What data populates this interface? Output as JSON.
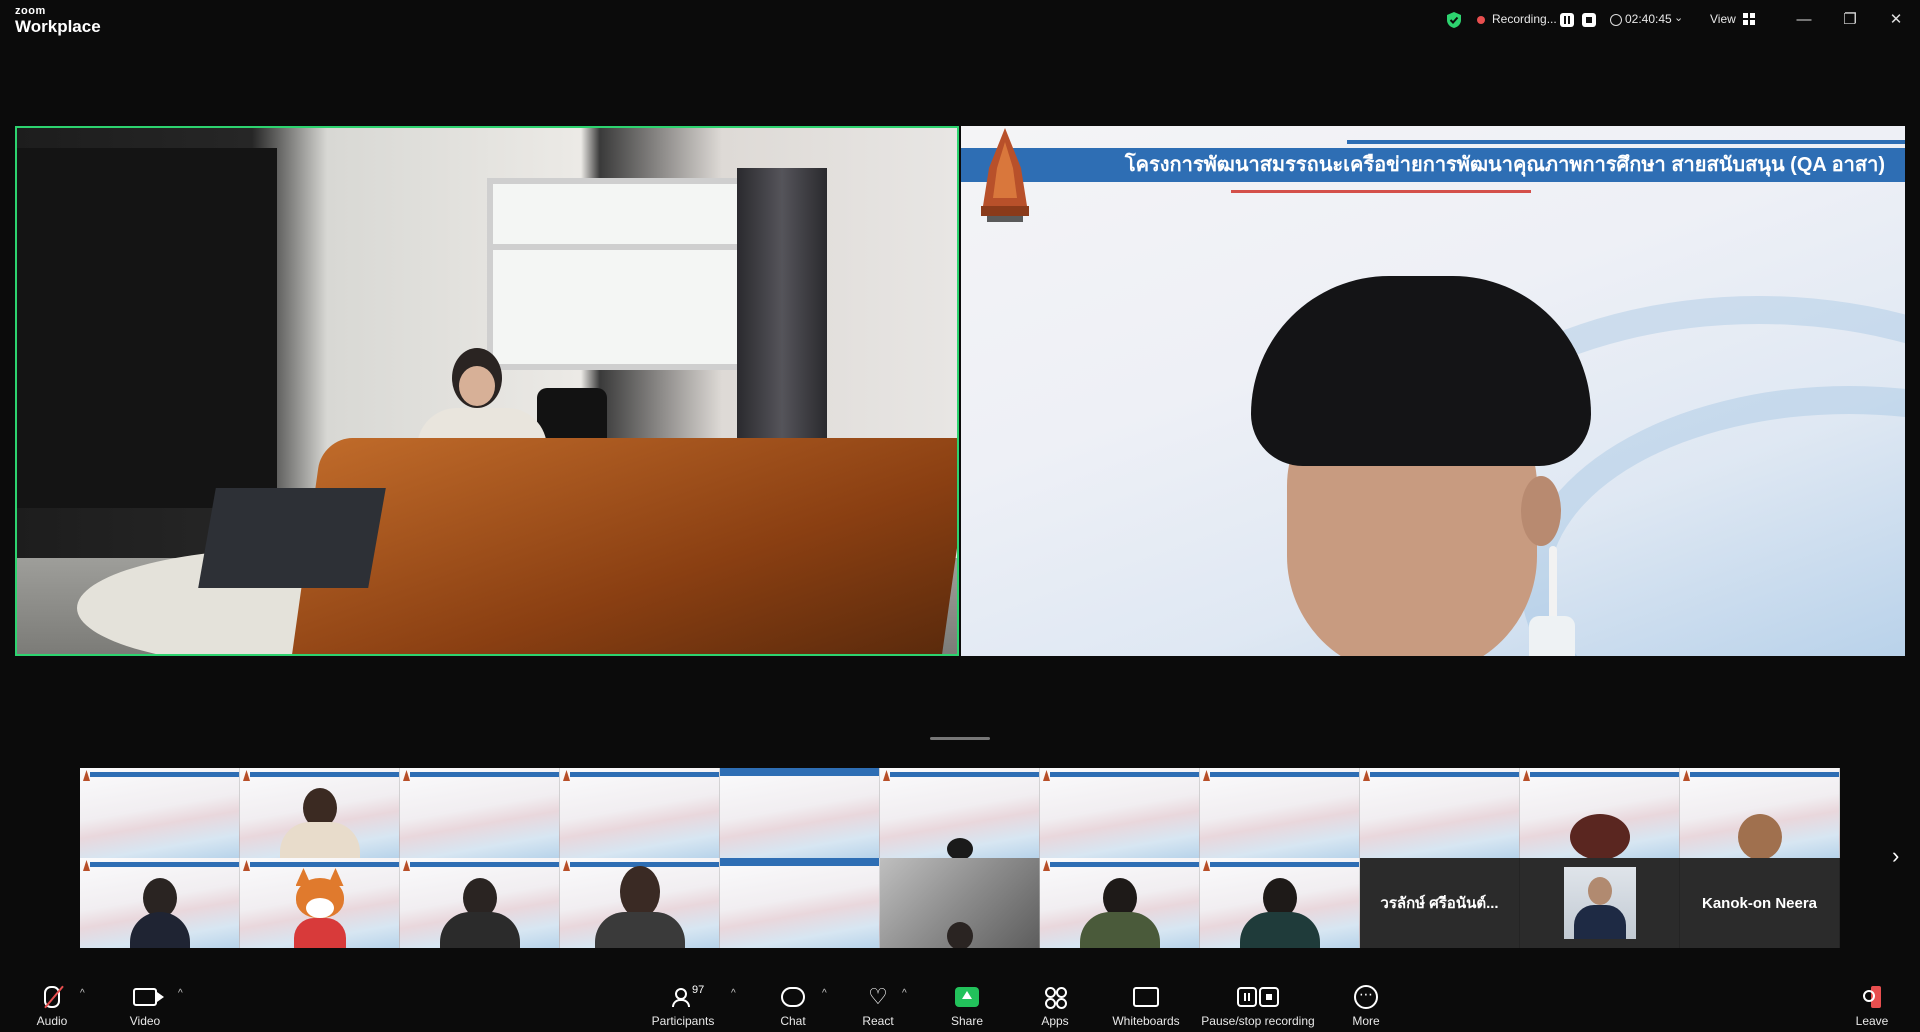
{
  "app": {
    "brand_small": "zoom",
    "brand_large": "Workplace"
  },
  "topbar": {
    "recording_label": "Recording...",
    "timer": "02:40:45",
    "view_label": "View",
    "timer_caret": "⌄",
    "minimize": "—",
    "restore": "❐",
    "close": "✕"
  },
  "slide": {
    "title": "โครงการพัฒนาสมรรถนะเครือข่ายการพัฒนาคุณภาพการศึกษา สายสนับสนุน (QA อาสา)"
  },
  "gallery": {
    "name_tile_1": "วรลักษ์  ศรีอนันต์...",
    "name_tile_2": "Kanok-on Neera",
    "next": "›"
  },
  "toolbar": {
    "audio": "Audio",
    "video": "Video",
    "participants": "Participants",
    "participants_count": "97",
    "chat": "Chat",
    "react": "React",
    "share": "Share",
    "apps": "Apps",
    "whiteboards": "Whiteboards",
    "pause_stop_recording": "Pause/stop recording",
    "more": "More",
    "leave": "Leave",
    "caret": "^",
    "more_dots": "⋯",
    "react_heart": "♡"
  },
  "colors": {
    "accent_green": "#2dd36f",
    "rec_red": "#e84f4f",
    "share_green": "#22c25b",
    "slide_blue": "#2e6eb4"
  }
}
